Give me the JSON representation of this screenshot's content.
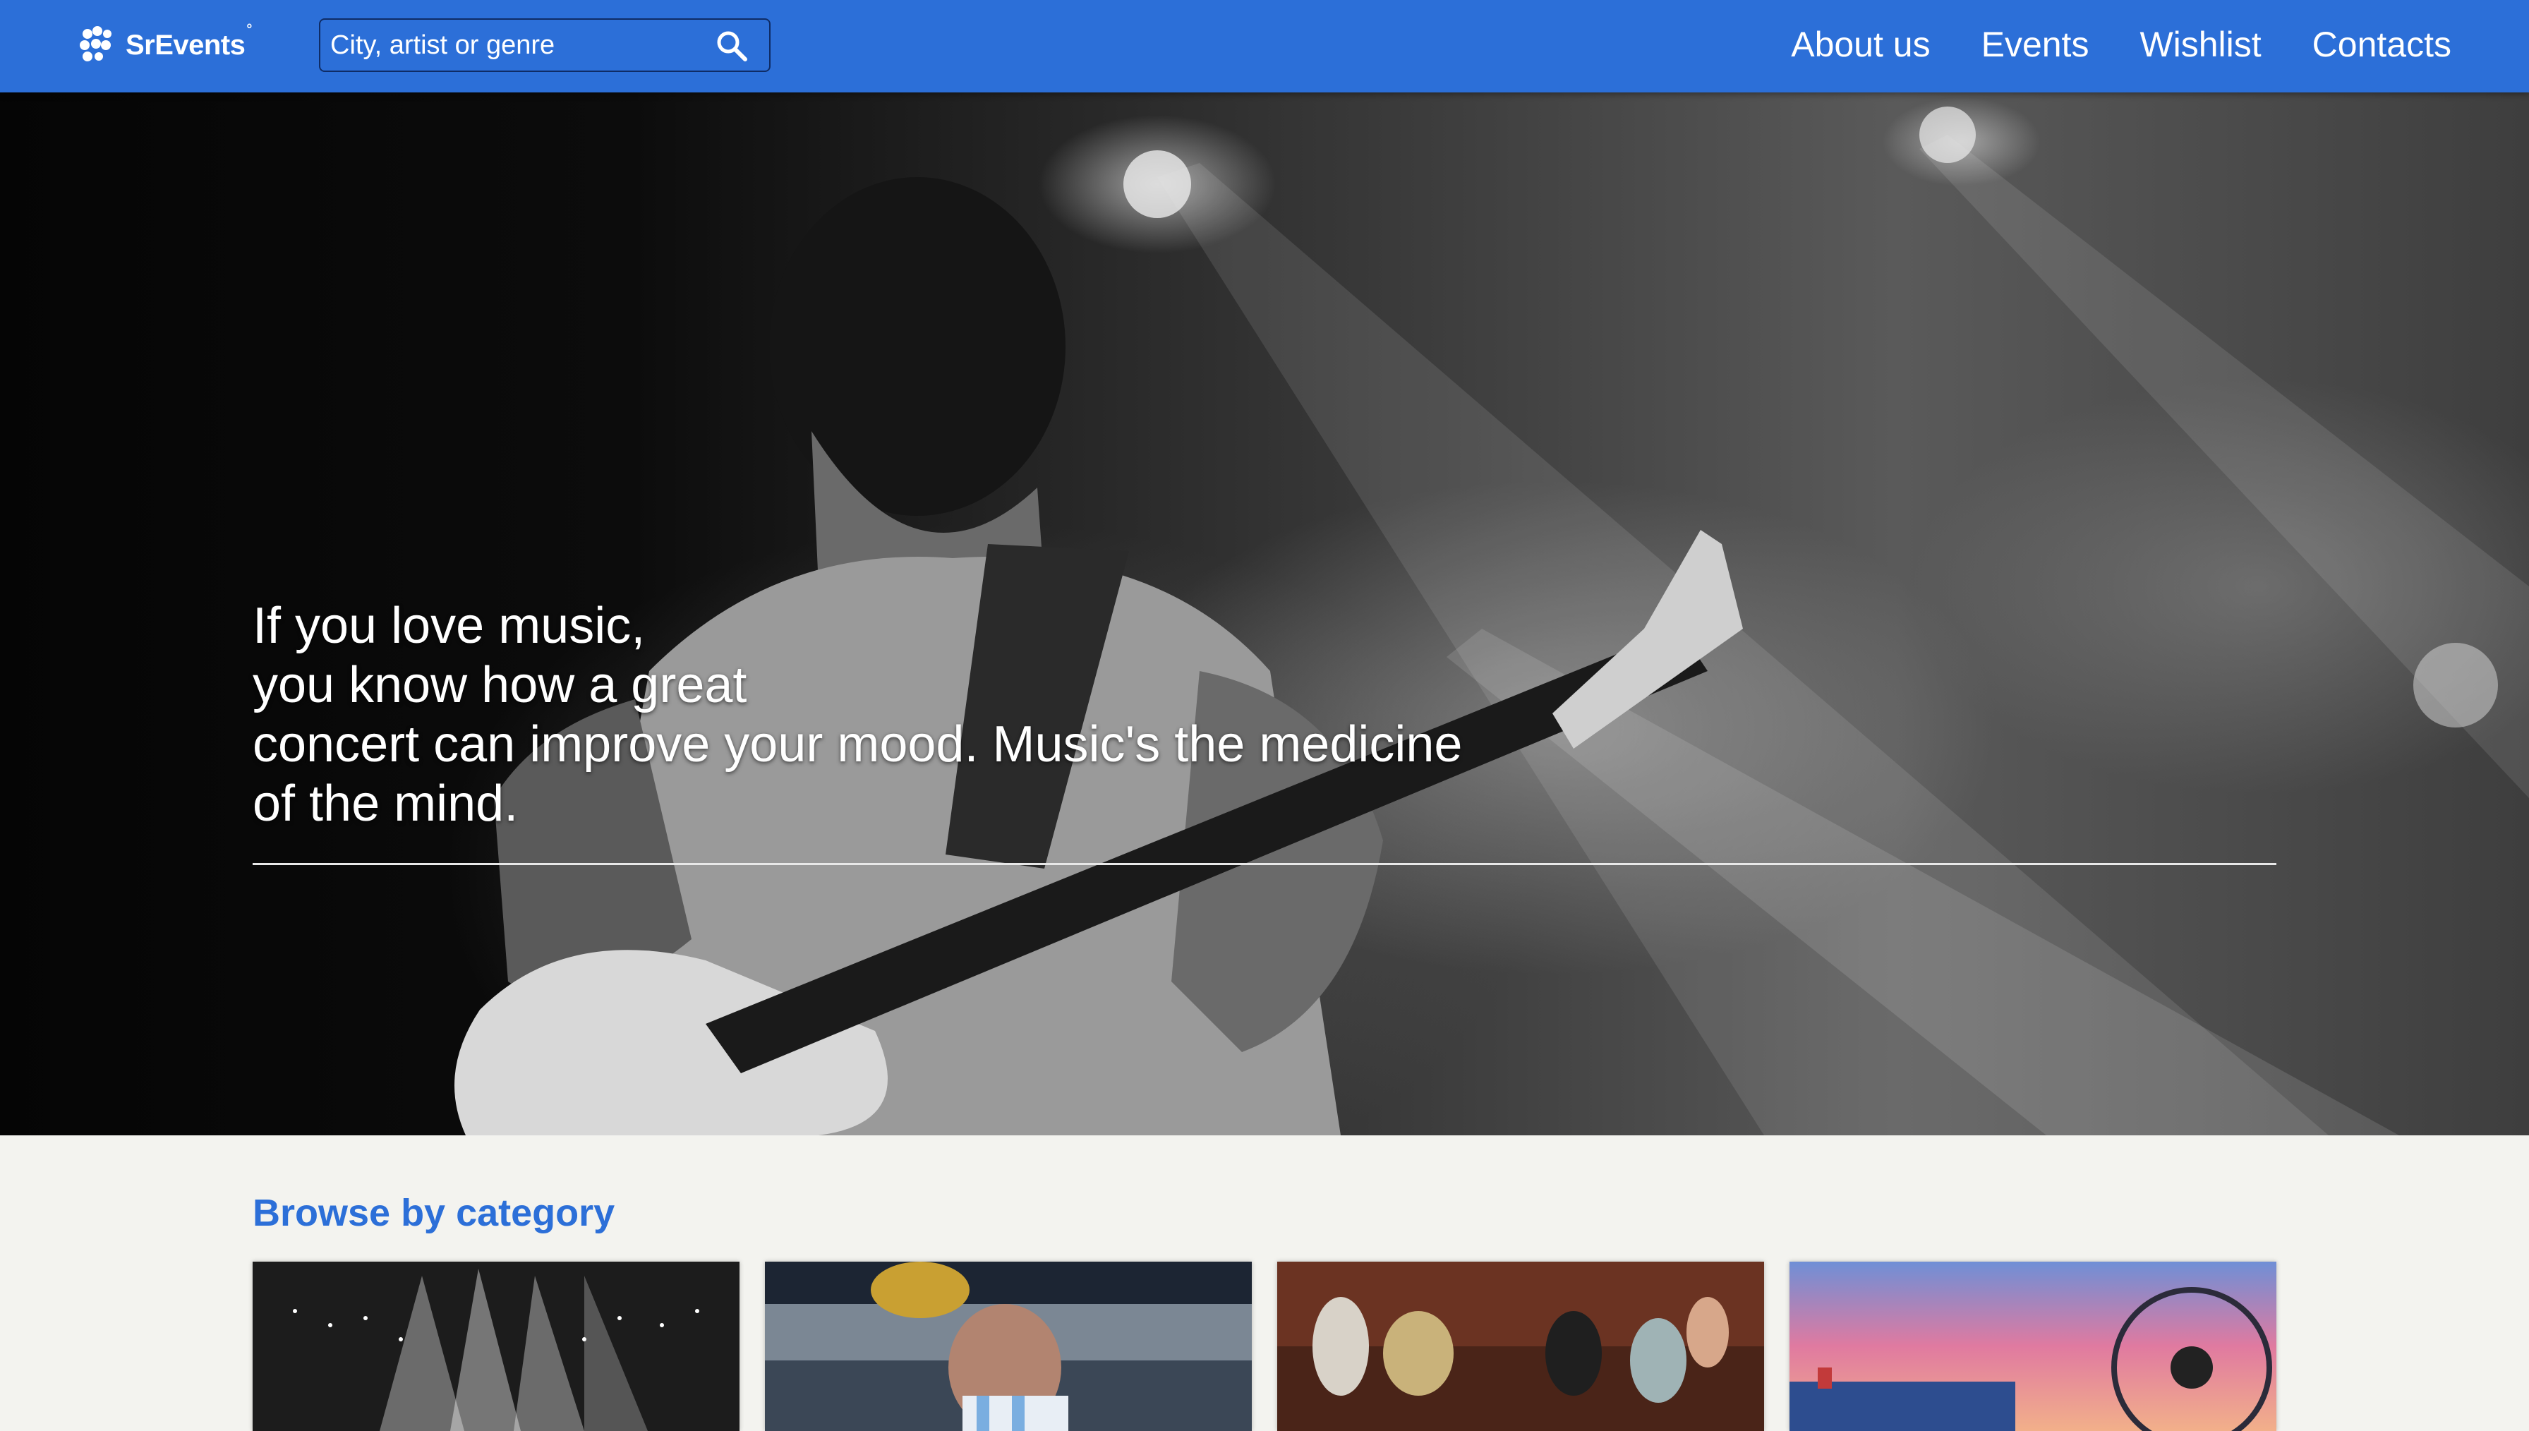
{
  "header": {
    "logo_text": "SrEvents",
    "logo_mark": "°",
    "search_placeholder": "City, artist or genre",
    "search_icon": "search-icon",
    "nav": [
      {
        "label": "About us"
      },
      {
        "label": "Events"
      },
      {
        "label": "Wishlist"
      },
      {
        "label": "Contacts"
      }
    ],
    "colors": {
      "bar": "#2c6fd8",
      "search_border": "#0f2c66"
    }
  },
  "hero": {
    "lines": [
      "If you love music,",
      "you know how a great",
      "concert can improve your mood. Music's the medicine",
      "of the mind."
    ]
  },
  "browse": {
    "title": "Browse by category",
    "title_color": "#2c6fd8",
    "cards": [
      {
        "image": "concert-stage-image"
      },
      {
        "image": "football-trophy-image"
      },
      {
        "image": "theatre-stage-image"
      },
      {
        "image": "amusement-park-image"
      }
    ]
  }
}
